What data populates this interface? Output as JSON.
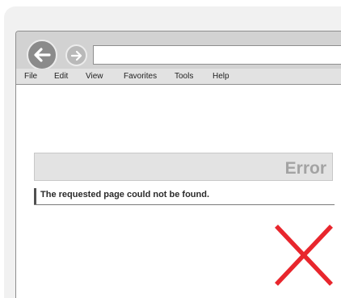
{
  "browser": {
    "address_value": "",
    "icons": {
      "back": "arrow-left-icon",
      "forward": "arrow-right-icon",
      "error_mark": "red-x-icon"
    }
  },
  "menu": {
    "items": [
      "File",
      "Edit",
      "View",
      "Favorites",
      "Tools",
      "Help"
    ]
  },
  "page": {
    "error_title": "Error",
    "error_message": "The requested page could not be found."
  },
  "colors": {
    "error_mark": "#e8262d",
    "toolbar": "#d2d2d2",
    "back_button": "#8b8b8b",
    "forward_button": "#b9b9b9"
  }
}
